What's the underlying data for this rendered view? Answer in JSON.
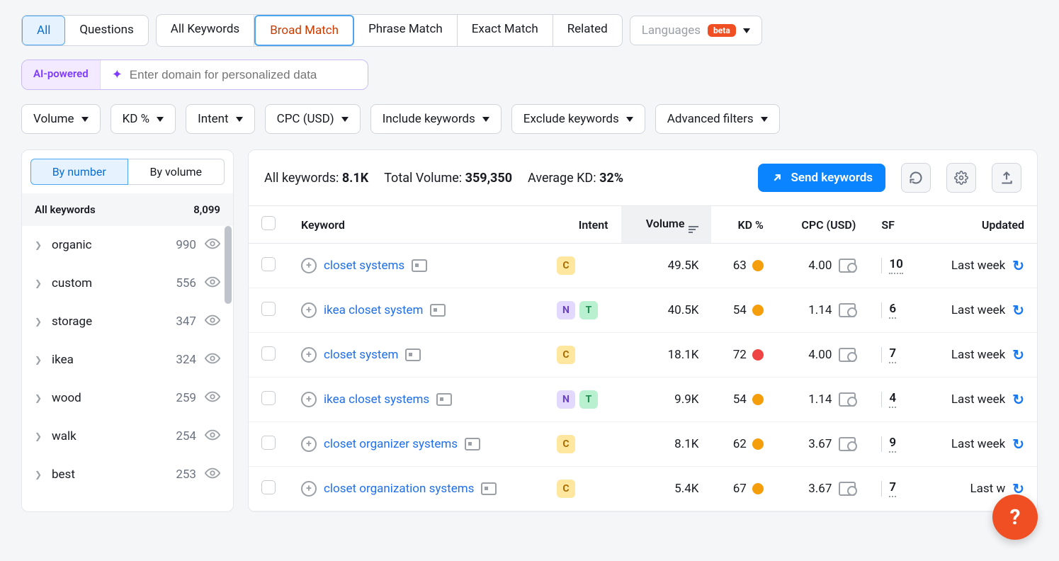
{
  "tabs1": {
    "all": "All",
    "questions": "Questions"
  },
  "tabs2": {
    "all_keywords": "All Keywords",
    "broad": "Broad Match",
    "phrase": "Phrase Match",
    "exact": "Exact Match",
    "related": "Related"
  },
  "languages": {
    "label": "Languages",
    "badge": "beta"
  },
  "ai": {
    "badge": "AI-powered",
    "placeholder": "Enter domain for personalized data"
  },
  "filters": {
    "volume": "Volume",
    "kd": "KD %",
    "intent": "Intent",
    "cpc": "CPC (USD)",
    "include": "Include keywords",
    "exclude": "Exclude keywords",
    "advanced": "Advanced filters"
  },
  "sidebar": {
    "tab_number": "By number",
    "tab_volume": "By volume",
    "header_label": "All keywords",
    "header_count": "8,099",
    "items": [
      {
        "label": "organic",
        "count": "990"
      },
      {
        "label": "custom",
        "count": "556"
      },
      {
        "label": "storage",
        "count": "347"
      },
      {
        "label": "ikea",
        "count": "324"
      },
      {
        "label": "wood",
        "count": "259"
      },
      {
        "label": "walk",
        "count": "254"
      },
      {
        "label": "best",
        "count": "253"
      }
    ]
  },
  "stats": {
    "all_label": "All keywords: ",
    "all_value": "8.1K",
    "tot_label": "Total Volume: ",
    "tot_value": "359,350",
    "avg_label": "Average KD: ",
    "avg_value": "32%",
    "send": "Send keywords"
  },
  "columns": {
    "keyword": "Keyword",
    "intent": "Intent",
    "volume": "Volume",
    "kd": "KD %",
    "cpc": "CPC (USD)",
    "sf": "SF",
    "updated": "Updated"
  },
  "rows": [
    {
      "kw": "closet systems",
      "intent": [
        "C"
      ],
      "volume": "49.5K",
      "kd": "63",
      "kd_color": "orange",
      "cpc": "4.00",
      "sf": "10",
      "updated": "Last week"
    },
    {
      "kw": "ikea closet system",
      "intent": [
        "N",
        "T"
      ],
      "volume": "40.5K",
      "kd": "54",
      "kd_color": "orange",
      "cpc": "1.14",
      "sf": "6",
      "updated": "Last week"
    },
    {
      "kw": "closet system",
      "intent": [
        "C"
      ],
      "volume": "18.1K",
      "kd": "72",
      "kd_color": "red",
      "cpc": "4.00",
      "sf": "7",
      "updated": "Last week"
    },
    {
      "kw": "ikea closet systems",
      "intent": [
        "N",
        "T"
      ],
      "volume": "9.9K",
      "kd": "54",
      "kd_color": "orange",
      "cpc": "1.14",
      "sf": "4",
      "updated": "Last week"
    },
    {
      "kw": "closet organizer systems",
      "intent": [
        "C"
      ],
      "volume": "8.1K",
      "kd": "62",
      "kd_color": "orange",
      "cpc": "3.67",
      "sf": "9",
      "updated": "Last week"
    },
    {
      "kw": "closet organization systems",
      "intent": [
        "C"
      ],
      "volume": "5.4K",
      "kd": "67",
      "kd_color": "orange",
      "cpc": "3.67",
      "sf": "7",
      "updated": "Last w"
    }
  ],
  "help": "?"
}
